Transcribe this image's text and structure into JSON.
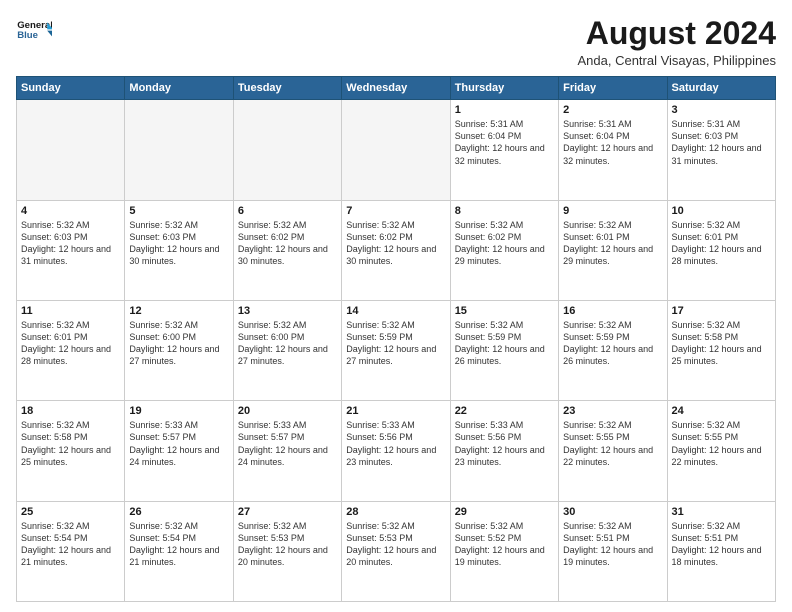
{
  "header": {
    "logo_line1": "General",
    "logo_line2": "Blue",
    "month_title": "August 2024",
    "location": "Anda, Central Visayas, Philippines"
  },
  "weekdays": [
    "Sunday",
    "Monday",
    "Tuesday",
    "Wednesday",
    "Thursday",
    "Friday",
    "Saturday"
  ],
  "weeks": [
    [
      {
        "day": "",
        "empty": true
      },
      {
        "day": "",
        "empty": true
      },
      {
        "day": "",
        "empty": true
      },
      {
        "day": "",
        "empty": true
      },
      {
        "day": "1",
        "sunrise": "5:31 AM",
        "sunset": "6:04 PM",
        "daylight": "12 hours and 32 minutes."
      },
      {
        "day": "2",
        "sunrise": "5:31 AM",
        "sunset": "6:04 PM",
        "daylight": "12 hours and 32 minutes."
      },
      {
        "day": "3",
        "sunrise": "5:31 AM",
        "sunset": "6:03 PM",
        "daylight": "12 hours and 31 minutes."
      }
    ],
    [
      {
        "day": "4",
        "sunrise": "5:32 AM",
        "sunset": "6:03 PM",
        "daylight": "12 hours and 31 minutes."
      },
      {
        "day": "5",
        "sunrise": "5:32 AM",
        "sunset": "6:03 PM",
        "daylight": "12 hours and 30 minutes."
      },
      {
        "day": "6",
        "sunrise": "5:32 AM",
        "sunset": "6:02 PM",
        "daylight": "12 hours and 30 minutes."
      },
      {
        "day": "7",
        "sunrise": "5:32 AM",
        "sunset": "6:02 PM",
        "daylight": "12 hours and 30 minutes."
      },
      {
        "day": "8",
        "sunrise": "5:32 AM",
        "sunset": "6:02 PM",
        "daylight": "12 hours and 29 minutes."
      },
      {
        "day": "9",
        "sunrise": "5:32 AM",
        "sunset": "6:01 PM",
        "daylight": "12 hours and 29 minutes."
      },
      {
        "day": "10",
        "sunrise": "5:32 AM",
        "sunset": "6:01 PM",
        "daylight": "12 hours and 28 minutes."
      }
    ],
    [
      {
        "day": "11",
        "sunrise": "5:32 AM",
        "sunset": "6:01 PM",
        "daylight": "12 hours and 28 minutes."
      },
      {
        "day": "12",
        "sunrise": "5:32 AM",
        "sunset": "6:00 PM",
        "daylight": "12 hours and 27 minutes."
      },
      {
        "day": "13",
        "sunrise": "5:32 AM",
        "sunset": "6:00 PM",
        "daylight": "12 hours and 27 minutes."
      },
      {
        "day": "14",
        "sunrise": "5:32 AM",
        "sunset": "5:59 PM",
        "daylight": "12 hours and 27 minutes."
      },
      {
        "day": "15",
        "sunrise": "5:32 AM",
        "sunset": "5:59 PM",
        "daylight": "12 hours and 26 minutes."
      },
      {
        "day": "16",
        "sunrise": "5:32 AM",
        "sunset": "5:59 PM",
        "daylight": "12 hours and 26 minutes."
      },
      {
        "day": "17",
        "sunrise": "5:32 AM",
        "sunset": "5:58 PM",
        "daylight": "12 hours and 25 minutes."
      }
    ],
    [
      {
        "day": "18",
        "sunrise": "5:32 AM",
        "sunset": "5:58 PM",
        "daylight": "12 hours and 25 minutes."
      },
      {
        "day": "19",
        "sunrise": "5:33 AM",
        "sunset": "5:57 PM",
        "daylight": "12 hours and 24 minutes."
      },
      {
        "day": "20",
        "sunrise": "5:33 AM",
        "sunset": "5:57 PM",
        "daylight": "12 hours and 24 minutes."
      },
      {
        "day": "21",
        "sunrise": "5:33 AM",
        "sunset": "5:56 PM",
        "daylight": "12 hours and 23 minutes."
      },
      {
        "day": "22",
        "sunrise": "5:33 AM",
        "sunset": "5:56 PM",
        "daylight": "12 hours and 23 minutes."
      },
      {
        "day": "23",
        "sunrise": "5:32 AM",
        "sunset": "5:55 PM",
        "daylight": "12 hours and 22 minutes."
      },
      {
        "day": "24",
        "sunrise": "5:32 AM",
        "sunset": "5:55 PM",
        "daylight": "12 hours and 22 minutes."
      }
    ],
    [
      {
        "day": "25",
        "sunrise": "5:32 AM",
        "sunset": "5:54 PM",
        "daylight": "12 hours and 21 minutes."
      },
      {
        "day": "26",
        "sunrise": "5:32 AM",
        "sunset": "5:54 PM",
        "daylight": "12 hours and 21 minutes."
      },
      {
        "day": "27",
        "sunrise": "5:32 AM",
        "sunset": "5:53 PM",
        "daylight": "12 hours and 20 minutes."
      },
      {
        "day": "28",
        "sunrise": "5:32 AM",
        "sunset": "5:53 PM",
        "daylight": "12 hours and 20 minutes."
      },
      {
        "day": "29",
        "sunrise": "5:32 AM",
        "sunset": "5:52 PM",
        "daylight": "12 hours and 19 minutes."
      },
      {
        "day": "30",
        "sunrise": "5:32 AM",
        "sunset": "5:51 PM",
        "daylight": "12 hours and 19 minutes."
      },
      {
        "day": "31",
        "sunrise": "5:32 AM",
        "sunset": "5:51 PM",
        "daylight": "12 hours and 18 minutes."
      }
    ]
  ]
}
